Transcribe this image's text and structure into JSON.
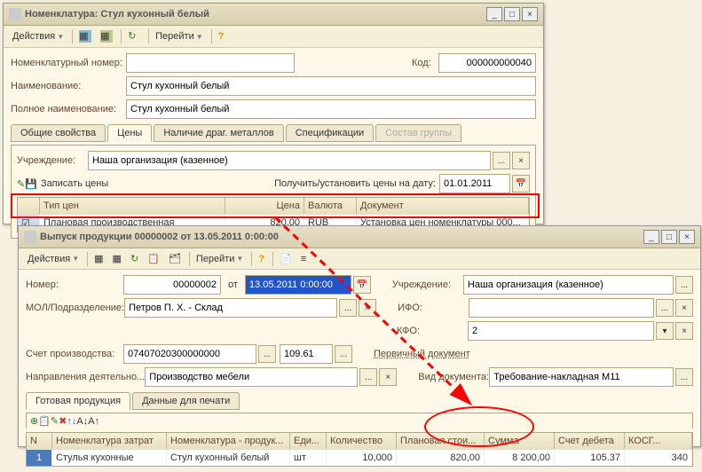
{
  "win1": {
    "title": "Номенклатура: Стул кухонный белый",
    "toolbar": {
      "actions": "Действия",
      "goto": "Перейти"
    },
    "labels": {
      "nomnum": "Номенклатурный номер:",
      "code": "Код:",
      "name": "Наименование:",
      "fullname": "Полное наименование:"
    },
    "values": {
      "nomnum": "",
      "code": "000000000040",
      "name": "Стул кухонный белый",
      "fullname": "Стул кухонный белый"
    },
    "tabs": [
      "Общие свойства",
      "Цены",
      "Наличие драг. металлов",
      "Спецификации",
      "Состав группы"
    ],
    "prices": {
      "org_lbl": "Учреждение:",
      "org": "Наша организация (казенное)",
      "write": "Записать цены",
      "getset": "Получить/установить цены на дату:",
      "date": "01.01.2011",
      "headers": {
        "type": "Тип цен",
        "price": "Цена",
        "cur": "Валюта",
        "doc": "Документ"
      },
      "row": {
        "type": "Плановая производственная",
        "price": "820,00",
        "cur": "RUB",
        "doc": "Установка цен номенклатуры 000..."
      }
    }
  },
  "win2": {
    "title": "Выпуск продукции 00000002 от 13.05.2011 0:00:00",
    "toolbar": {
      "actions": "Действия",
      "goto": "Перейти"
    },
    "labels": {
      "num": "Номер:",
      "from": "от",
      "org": "Учреждение:",
      "mol": "МОЛ/Подразделение:",
      "ifo": "ИФО:",
      "kfo": "КФО:",
      "acct": "Счет производства:",
      "dir": "Направления деятельно...",
      "prim": "Первичный документ",
      "vid": "Вид документа:"
    },
    "values": {
      "num": "00000002",
      "date": "13.05.2011 0:00:00",
      "org": "Наша организация (казенное)",
      "mol": "Петров П. Х. - Склад",
      "ifo": "",
      "kfo": "2",
      "acct1": "07407020300000000",
      "acct2": "109.61",
      "dir": "Производство мебели",
      "vid": "Требование-накладная М11"
    },
    "tabs": [
      "Готовая продукция",
      "Данные для печати"
    ],
    "grid": {
      "headers": {
        "n": "N",
        "nz": "Номенклатура затрат",
        "np": "Номенклатура - продук...",
        "ed": "Еди...",
        "qty": "Количество",
        "plan": "Плановая стои...",
        "sum": "Сумма",
        "deb": "Счет дебета",
        "kosg": "КОСГ..."
      },
      "row": {
        "n": "1",
        "nz": "Стулья кухонные",
        "np": "Стул кухонный белый",
        "ed": "шт",
        "qty": "10,000",
        "plan": "820,00",
        "sum": "8 200,00",
        "deb": "105.37",
        "kosg": "340"
      }
    }
  }
}
